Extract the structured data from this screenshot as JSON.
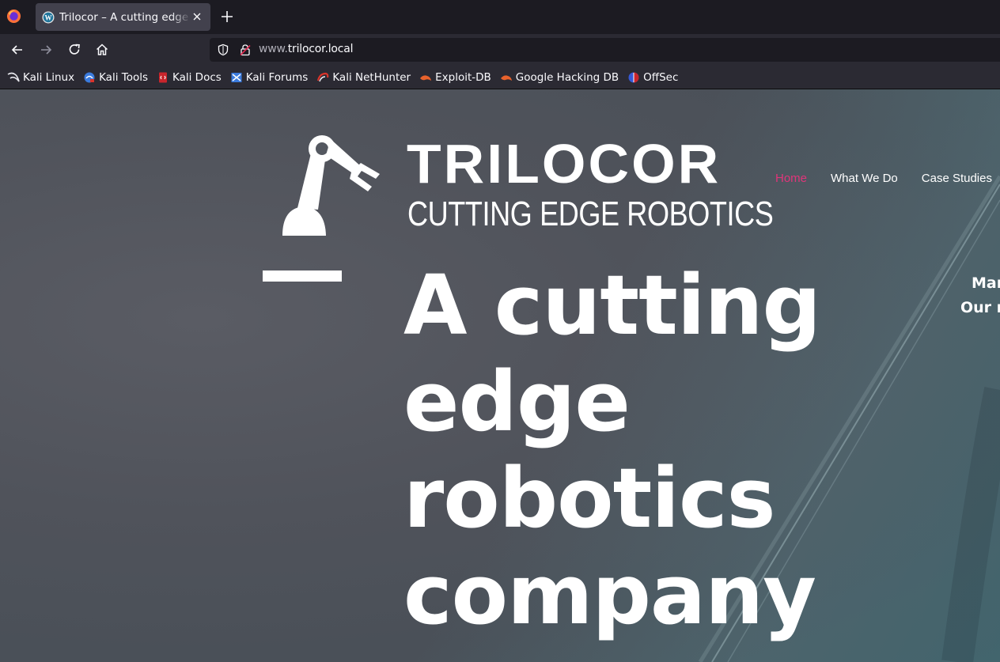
{
  "browser": {
    "tab_title": "Trilocor – A cutting edge robotics company",
    "url_prefix": "www.",
    "url_domain": "trilocor.local",
    "bookmarks": [
      {
        "label": "Kali Linux",
        "icon": "kali-dragon-icon"
      },
      {
        "label": "Kali Tools",
        "icon": "kali-tools-icon"
      },
      {
        "label": "Kali Docs",
        "icon": "kali-docs-icon"
      },
      {
        "label": "Kali Forums",
        "icon": "kali-forums-icon"
      },
      {
        "label": "Kali NetHunter",
        "icon": "kali-nethunter-icon"
      },
      {
        "label": "Exploit-DB",
        "icon": "exploit-db-icon"
      },
      {
        "label": "Google Hacking DB",
        "icon": "ghdb-icon"
      },
      {
        "label": "OffSec",
        "icon": "offsec-icon"
      }
    ]
  },
  "site": {
    "brand_name": "TRILOCOR",
    "brand_tagline": "CUTTING EDGE ROBOTICS",
    "menu": [
      {
        "label": "Home",
        "active": true
      },
      {
        "label": "What We Do",
        "active": false
      },
      {
        "label": "Case Studies",
        "active": false
      }
    ],
    "active_color": "#e0357a",
    "hero_title": "A cutting edge robotics company",
    "side_line_1": "Mar",
    "side_line_2": "Our r"
  }
}
